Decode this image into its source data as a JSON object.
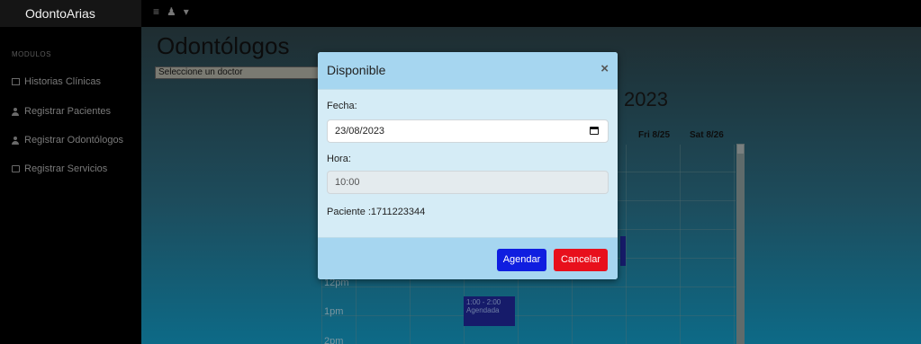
{
  "app": {
    "brand": "OdontoArias"
  },
  "topbar": {
    "menu_icon": "hamburger-icon",
    "user_icon": "user-icon",
    "caret": "▾"
  },
  "sidebar": {
    "section": "MODULOS",
    "items": [
      {
        "label": "Historias Clínicas",
        "icon": "document-icon"
      },
      {
        "label": "Registrar Pacientes",
        "icon": "user-add-icon"
      },
      {
        "label": "Registrar Odontólogos",
        "icon": "user-add-icon"
      },
      {
        "label": "Registrar Servicios",
        "icon": "card-icon"
      }
    ]
  },
  "main": {
    "title": "Odontólogos",
    "doctor_select": "Seleccione un doctor",
    "calendar": {
      "year_label": "2023",
      "headers": [
        "Fri 8/25",
        "Sat 8/26"
      ],
      "times": [
        "12pm",
        "1pm",
        "2pm"
      ],
      "events": [
        {
          "time": "1:00 - 2:00",
          "label": "Agendada"
        }
      ]
    }
  },
  "modal": {
    "title": "Disponible",
    "close": "×",
    "fecha_label": "Fecha:",
    "fecha_value": "23/08/2023",
    "hora_label": "Hora:",
    "hora_value": "10:00",
    "paciente": "Paciente :1711223344",
    "agendar": "Agendar",
    "cancelar": "Cancelar"
  },
  "colors": {
    "primary": "#0f1ee0",
    "danger": "#e8101c",
    "modal_header": "#a6d6f0",
    "modal_body": "#d5ecf6"
  }
}
